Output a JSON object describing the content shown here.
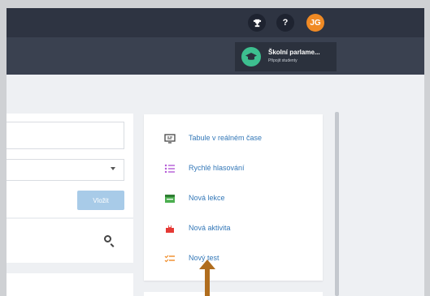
{
  "header": {
    "avatar_initials": "JG",
    "help_label": "?"
  },
  "school": {
    "name": "Školní parlame...",
    "subtitle": "Připojit studenty"
  },
  "form": {
    "insert_label": "Vložit"
  },
  "menu": {
    "items": [
      {
        "label": "Tabule v reálném čase",
        "icon": "whiteboard-icon",
        "color": "#444444"
      },
      {
        "label": "Rychlé hlasování",
        "icon": "list-icon",
        "color": "#b45ad6"
      },
      {
        "label": "Nová lekce",
        "icon": "lesson-icon",
        "color": "#4caf50"
      },
      {
        "label": "Nová aktivita",
        "icon": "activity-icon",
        "color": "#e53935"
      },
      {
        "label": "Nový test",
        "icon": "test-icon",
        "color": "#f08a24"
      }
    ]
  },
  "colors": {
    "topbar": "#2e3442",
    "accent_link": "#3478b8",
    "avatar": "#f08a24",
    "school_icon": "#3dbf8f",
    "pointer_arrow": "#b06d1e"
  }
}
